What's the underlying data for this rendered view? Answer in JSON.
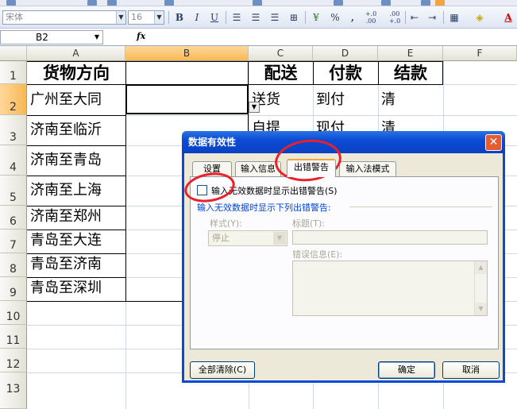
{
  "toolbar": {
    "font_name": "宋体",
    "font_size": "16",
    "bold": "B",
    "italic": "I",
    "underline": "U",
    "percent": "%",
    "comma": ",",
    "inc_decimal": "+.0 .00",
    "dec_decimal": ".00 +.0",
    "font_color_glyph": "A"
  },
  "formula_bar": {
    "name_box": "B2",
    "fx": "fx"
  },
  "sheet": {
    "columns": [
      "A",
      "B",
      "C",
      "D",
      "E",
      "F"
    ],
    "rows": [
      "1",
      "2",
      "3",
      "4",
      "5",
      "6",
      "7",
      "8",
      "9",
      "10",
      "11",
      "12",
      "13"
    ],
    "header_row": {
      "a": "货物方向",
      "c": "配送",
      "d": "付款",
      "e": "结款"
    },
    "col_a": [
      "广州至大同",
      "济南至临沂",
      "济南至青岛",
      "济南至上海",
      "济南至郑州",
      "青岛至大连",
      "青岛至济南",
      "青岛至深圳"
    ],
    "row2": {
      "c": "送货",
      "d": "到付",
      "e": "清"
    },
    "row3": {
      "c": "自提",
      "d": "现付",
      "e": "清"
    }
  },
  "dialog": {
    "title": "数据有效性",
    "close": "✕",
    "tabs": [
      {
        "label": "设置"
      },
      {
        "label": "输入信息"
      },
      {
        "label": "出错警告"
      },
      {
        "label": "输入法模式"
      }
    ],
    "checkbox_label": "输入无效数据时显示出错警告(S)",
    "group_label": "输入无效数据时显示下列出错警告:",
    "style_label": "样式(Y):",
    "style_value": "停止",
    "title_label": "标题(T):",
    "title_value": "",
    "error_label": "错误信息(E):",
    "error_value": "",
    "clear_all": "全部清除(C)",
    "ok": "确定",
    "cancel": "取消"
  },
  "colors": {
    "annotation": "#e8212a",
    "dialog_title": "#0b4bd4",
    "selected_header": "#f8b954"
  }
}
